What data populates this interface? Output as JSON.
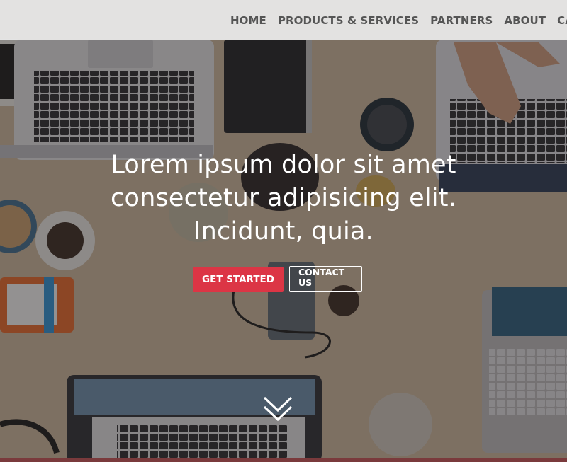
{
  "nav": {
    "items": [
      {
        "label": "HOME"
      },
      {
        "label": "PRODUCTS & SERVICES"
      },
      {
        "label": "PARTNERS"
      },
      {
        "label": "ABOUT"
      },
      {
        "label": "CAREERS"
      }
    ]
  },
  "hero": {
    "heading_line1": "Lorem ipsum dolor sit amet",
    "heading_line2": "consectetur adipisicing elit.",
    "heading_line3": "Incidunt, quia.",
    "primary_button": "GET STARTED",
    "secondary_button": "CONTACT US",
    "scroll_icon": "double-chevron-down-icon"
  },
  "colors": {
    "primary_button_bg": "#dc3545",
    "nav_bg": "#ececec",
    "nav_text": "#555555",
    "hero_text": "#ffffff"
  }
}
